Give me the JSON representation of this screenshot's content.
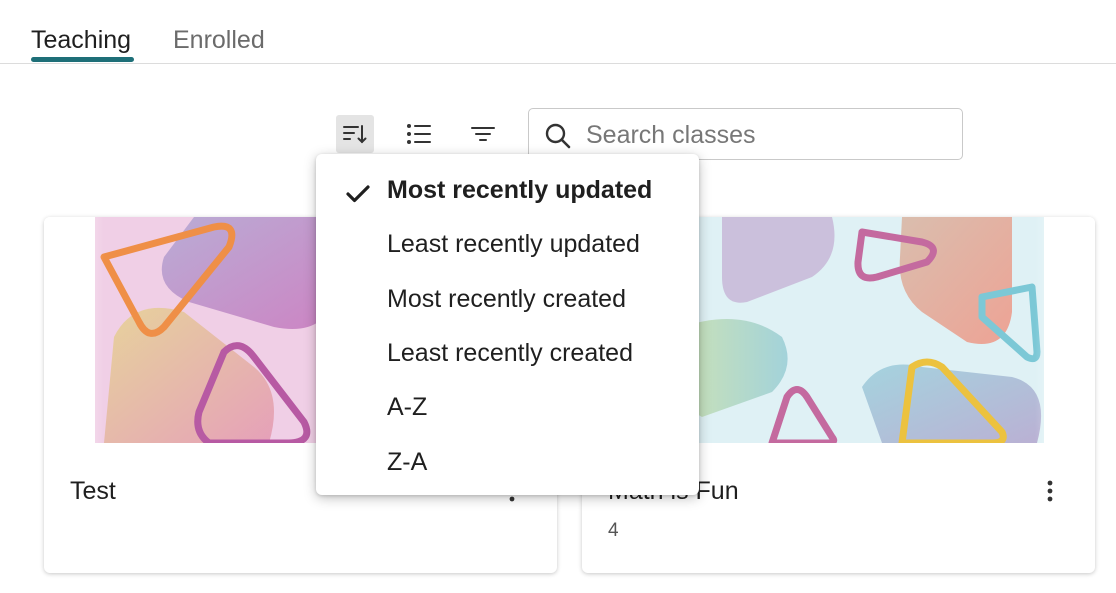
{
  "tabs": [
    {
      "label": "Teaching",
      "active": true
    },
    {
      "label": "Enrolled",
      "active": false
    }
  ],
  "toolbar": {
    "sort_icon": "sort-descending-icon",
    "list_icon": "list-view-icon",
    "filter_icon": "filter-icon"
  },
  "search": {
    "placeholder": "Search classes",
    "value": ""
  },
  "sort_menu": {
    "selected": "Most recently updated",
    "items": [
      {
        "label": "Most recently updated",
        "selected": true
      },
      {
        "label": "Least recently updated",
        "selected": false
      },
      {
        "label": "Most recently created",
        "selected": false
      },
      {
        "label": "Least recently created",
        "selected": false
      },
      {
        "label": "A-Z",
        "selected": false
      },
      {
        "label": "Z-A",
        "selected": false
      }
    ]
  },
  "cards": [
    {
      "title": "Test",
      "count": ""
    },
    {
      "title": "Math is Fun",
      "count": "4"
    }
  ],
  "colors": {
    "accent": "#1e6f78",
    "sort_button_bg": "#e4e4e4"
  }
}
